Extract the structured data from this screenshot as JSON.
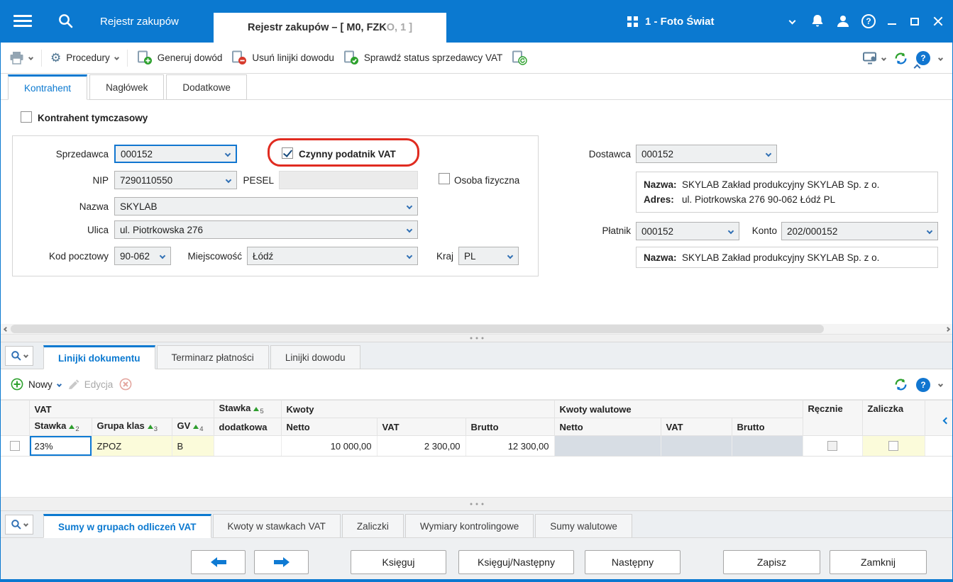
{
  "icons": {
    "gear_glyph": "⚙",
    "help_glyph": "?"
  },
  "titlebar": {
    "nav_label": "Rejestr zakupów",
    "doc_tab_main": "Rejestr zakupów – [ M0, FZK",
    "doc_tab_dim": "O, 1 ]",
    "company": "1 - Foto Świat"
  },
  "toolbar": {
    "procedury": "Procedury",
    "generuj_dowod": "Generuj dowód",
    "usun_linijki": "Usuń linijki dowodu",
    "sprawdz_status": "Sprawdź status sprzedawcy VAT"
  },
  "top_tabs": [
    "Kontrahent",
    "Nagłówek",
    "Dodatkowe"
  ],
  "form": {
    "kontrahent_tymczasowy_label": "Kontrahent tymczasowy",
    "sprzedawca_label": "Sprzedawca",
    "sprzedawca_value": "000152",
    "czynny_podatnik_label": "Czynny podatnik VAT",
    "nip_label": "NIP",
    "nip_value": "7290110550",
    "pesel_label": "PESEL",
    "pesel_value": "",
    "osoba_fizyczna_label": "Osoba fizyczna",
    "nazwa_label": "Nazwa",
    "nazwa_value": "SKYLAB",
    "ulica_label": "Ulica",
    "ulica_value": "ul. Piotrkowska 276",
    "kod_pocztowy_label": "Kod pocztowy",
    "kod_pocztowy_value": "90-062",
    "miejscowosc_label": "Miejscowość",
    "miejscowosc_value": "Łódź",
    "kraj_label": "Kraj",
    "kraj_value": "PL"
  },
  "supplier_panel": {
    "dostawca_label": "Dostawca",
    "dostawca_value": "000152",
    "nazwa_label": "Nazwa:",
    "nazwa_value": "SKYLAB Zakład produkcyjny SKYLAB Sp. z o.",
    "adres_label": "Adres:",
    "adres_value": "ul. Piotrkowska 276 90-062 Łódź PL",
    "platnik_label": "Płatnik",
    "platnik_value": "000152",
    "konto_label": "Konto",
    "konto_value": "202/000152",
    "platnik_nazwa_label": "Nazwa:",
    "platnik_nazwa_value": "SKYLAB Zakład produkcyjny SKYLAB Sp. z o."
  },
  "middle_tabs": [
    "Linijki dokumentu",
    "Terminarz płatności",
    "Linijki dowodu"
  ],
  "middle_toolbar": {
    "nowy": "Nowy",
    "edycja": "Edycja"
  },
  "grid": {
    "group_headers": {
      "vat": "VAT",
      "stawka_top": "Stawka",
      "stawka_bottom": "dodatkowa",
      "kwoty": "Kwoty",
      "kwoty_walutowe": "Kwoty walutowe",
      "recznie": "Ręcznie",
      "zaliczka": "Zaliczka"
    },
    "sub_headers": {
      "stawka": "Stawka",
      "grupa_klas": "Grupa klas",
      "gv": "GV",
      "netto": "Netto",
      "vat": "VAT",
      "brutto": "Brutto"
    },
    "sort_orders": {
      "stawka": "2",
      "grupa_klas": "3",
      "gv": "4",
      "stawka_dodatkowa": "5"
    },
    "rows": [
      {
        "stawka": "23%",
        "grupa_klas": "ZPOZ",
        "gv": "B",
        "stawka_dodatkowa": "",
        "netto": "10 000,00",
        "vat": "2 300,00",
        "brutto": "12 300,00"
      }
    ]
  },
  "bottom_tabs": [
    "Sumy w grupach odliczeń VAT",
    "Kwoty w stawkach VAT",
    "Zaliczki",
    "Wymiary kontrolingowe",
    "Sumy walutowe"
  ],
  "footer_buttons": {
    "ksieguj": "Księguj",
    "ksieguj_nastepny": "Księguj/Następny",
    "nastepny": "Następny",
    "zapisz": "Zapisz",
    "zamknij": "Zamknij"
  }
}
